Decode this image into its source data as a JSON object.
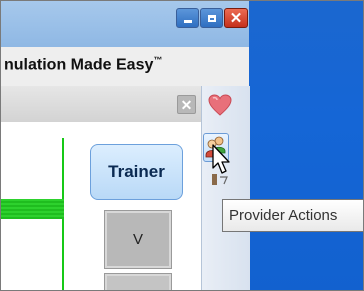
{
  "window": {
    "minimize_icon": "minimize-icon",
    "maximize_icon": "maximize-icon",
    "close_glyph": "✕",
    "close_color": "#d9432a"
  },
  "app": {
    "title": "nulation Made Easy",
    "title_mark": "™"
  },
  "panel": {
    "close_glyph": "✕"
  },
  "main": {
    "trainer_label": "Trainer",
    "tile_label": "V"
  },
  "sidebar": {
    "heart_icon": "heart-icon",
    "provider_icon": "provider-users-icon",
    "tooltip": "Provider Actions"
  },
  "colors": {
    "desktop": "#1566d6",
    "accent_green": "#16c916",
    "trainer_bg": "#cfe6fc"
  }
}
